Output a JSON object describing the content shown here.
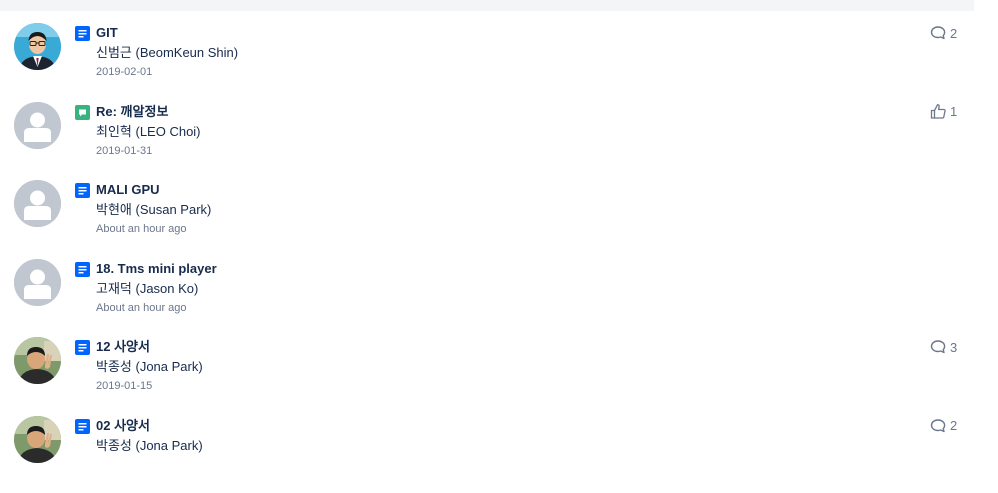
{
  "feed": {
    "items": [
      {
        "title": "GIT",
        "author": "신범근 (BeomKeun Shin)",
        "date": "2019-02-01",
        "type": "page",
        "avatar": "photo-man-glasses",
        "meta_icon": "comment-icon",
        "meta_count": "2"
      },
      {
        "title": "Re: 깨알정보",
        "author": "최인혁 (LEO Choi)",
        "date": "2019-01-31",
        "type": "comment",
        "avatar": "default-avatar",
        "meta_icon": "like-icon",
        "meta_count": "1"
      },
      {
        "title": "MALI GPU",
        "author": "박현애 (Susan Park)",
        "date": "About an hour ago",
        "type": "page",
        "avatar": "default-avatar",
        "meta_icon": "",
        "meta_count": ""
      },
      {
        "title": "18. Tms mini player",
        "author": "고재덕 (Jason Ko)",
        "date": "About an hour ago",
        "type": "page",
        "avatar": "default-avatar",
        "meta_icon": "",
        "meta_count": ""
      },
      {
        "title": "12 사양서",
        "author": "박종성 (Jona Park)",
        "date": "2019-01-15",
        "type": "page",
        "avatar": "photo-man-peace",
        "meta_icon": "comment-icon",
        "meta_count": "3"
      },
      {
        "title": "02 사양서",
        "author": "박종성 (Jona Park)",
        "date": "",
        "type": "page",
        "avatar": "photo-man-peace",
        "meta_icon": "comment-icon",
        "meta_count": "2"
      }
    ]
  },
  "colors": {
    "page_icon": "#0065ff",
    "comment_icon": "#36b37e",
    "default_avatar_bg": "#c1c7d0",
    "meta_grey": "#6b778c",
    "title_text": "#172b4d"
  }
}
